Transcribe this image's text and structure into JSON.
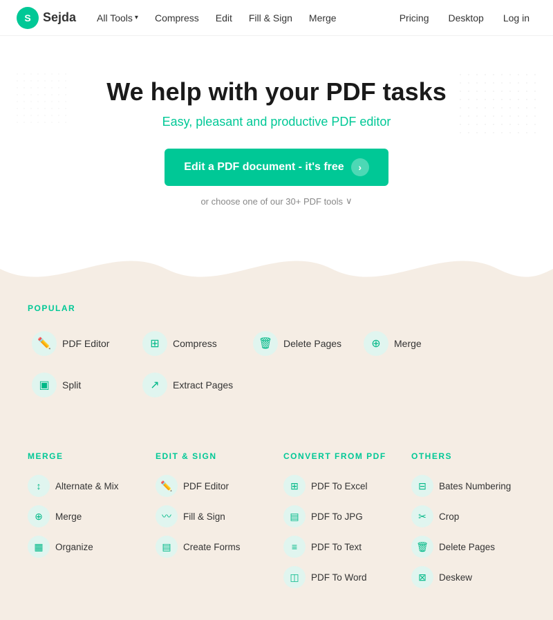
{
  "header": {
    "logo_text": "Sejda",
    "nav_items": [
      {
        "label": "All Tools",
        "has_dropdown": true
      },
      {
        "label": "Compress"
      },
      {
        "label": "Edit"
      },
      {
        "label": "Fill & Sign"
      },
      {
        "label": "Merge"
      }
    ],
    "nav_right": [
      {
        "label": "Pricing"
      },
      {
        "label": "Desktop"
      },
      {
        "label": "Log in"
      }
    ]
  },
  "hero": {
    "title": "We help with your PDF tasks",
    "subtitle": "Easy, pleasant and productive PDF editor",
    "cta_bold": "Edit a PDF document",
    "cta_suffix": " - it's free",
    "choose_tools_text": "or choose one of our 30+ PDF tools"
  },
  "popular_section": {
    "label": "POPULAR",
    "tools": [
      {
        "name": "PDF Editor",
        "icon": "✏️"
      },
      {
        "name": "Compress",
        "icon": "⊞"
      },
      {
        "name": "Delete Pages",
        "icon": "🗑"
      },
      {
        "name": "Merge",
        "icon": "⊕"
      },
      {
        "name": "Split",
        "icon": "▣"
      },
      {
        "name": "Extract Pages",
        "icon": "↗"
      }
    ]
  },
  "columns": [
    {
      "title": "MERGE",
      "tools": [
        {
          "name": "Alternate & Mix",
          "icon": "↕"
        },
        {
          "name": "Merge",
          "icon": "⊕"
        },
        {
          "name": "Organize",
          "icon": "▦"
        }
      ]
    },
    {
      "title": "EDIT & SIGN",
      "tools": [
        {
          "name": "PDF Editor",
          "icon": "✏️"
        },
        {
          "name": "Fill & Sign",
          "icon": "〰"
        },
        {
          "name": "Create Forms",
          "icon": "▤"
        }
      ]
    },
    {
      "title": "CONVERT FROM PDF",
      "tools": [
        {
          "name": "PDF To Excel",
          "icon": "⊞"
        },
        {
          "name": "PDF To JPG",
          "icon": "▤"
        },
        {
          "name": "PDF To Text",
          "icon": "≡"
        },
        {
          "name": "PDF To Word",
          "icon": "◫"
        }
      ]
    },
    {
      "title": "OTHERS",
      "tools": [
        {
          "name": "Bates Numbering",
          "icon": "⊟"
        },
        {
          "name": "Crop",
          "icon": "✂"
        },
        {
          "name": "Delete Pages",
          "icon": "🗑"
        },
        {
          "name": "Deskew",
          "icon": "⊠"
        }
      ]
    }
  ]
}
